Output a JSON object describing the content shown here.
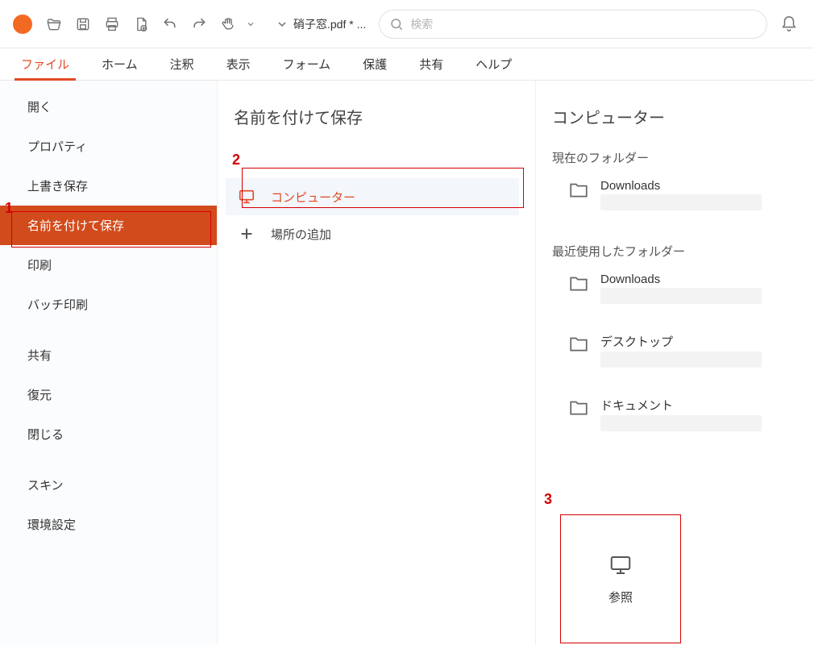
{
  "colors": {
    "brand": "#e24a25",
    "selected_bg": "#d24b1c",
    "callout": "#d40000"
  },
  "titlebar": {
    "filename": "硝子窓.pdf * ...",
    "search_placeholder": "検索"
  },
  "ribbon": {
    "tabs": [
      {
        "id": "file",
        "label": "ファイル",
        "active": true
      },
      {
        "id": "home",
        "label": "ホーム"
      },
      {
        "id": "comment",
        "label": "注釈"
      },
      {
        "id": "view",
        "label": "表示"
      },
      {
        "id": "form",
        "label": "フォーム"
      },
      {
        "id": "protect",
        "label": "保護"
      },
      {
        "id": "share",
        "label": "共有"
      },
      {
        "id": "help",
        "label": "ヘルプ"
      }
    ]
  },
  "file_menu": {
    "items": [
      {
        "id": "open",
        "label": "開く"
      },
      {
        "id": "properties",
        "label": "プロパティ"
      },
      {
        "id": "save",
        "label": "上書き保存"
      },
      {
        "id": "save_as",
        "label": "名前を付けて保存",
        "selected": true
      },
      {
        "id": "print",
        "label": "印刷"
      },
      {
        "id": "batch_print",
        "label": "バッチ印刷"
      },
      {
        "id": "share",
        "label": "共有"
      },
      {
        "id": "revert",
        "label": "復元"
      },
      {
        "id": "close",
        "label": "閉じる"
      },
      {
        "id": "skin",
        "label": "スキン"
      },
      {
        "id": "preferences",
        "label": "環境設定"
      }
    ]
  },
  "save_as": {
    "title": "名前を付けて保存",
    "locations": [
      {
        "id": "computer",
        "label": "コンピューター",
        "selected": true,
        "icon": "monitor"
      },
      {
        "id": "add_place",
        "label": "場所の追加",
        "icon": "plus"
      }
    ]
  },
  "right": {
    "title": "コンピューター",
    "current_folder_label": "現在のフォルダー",
    "current_folder": {
      "name": "Downloads"
    },
    "recent_folders_label": "最近使用したフォルダー",
    "recent_folders": [
      {
        "name": "Downloads"
      },
      {
        "name": "デスクトップ"
      },
      {
        "name": "ドキュメント"
      }
    ],
    "browse_label": "参照"
  },
  "callouts": {
    "c1": "1",
    "c2": "2",
    "c3": "3"
  }
}
